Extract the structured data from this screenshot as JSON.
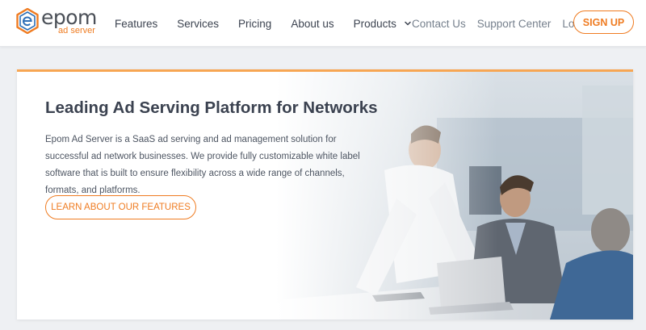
{
  "brand": {
    "name": "epom",
    "subtitle": "ad server",
    "accent": "#ef7c22",
    "highlight_bar": "#f7a653"
  },
  "nav": {
    "primary": [
      {
        "label": "Features"
      },
      {
        "label": "Services"
      },
      {
        "label": "Pricing"
      },
      {
        "label": "About us"
      },
      {
        "label": "Products"
      }
    ],
    "secondary": [
      {
        "label": "Contact Us"
      },
      {
        "label": "Support Center"
      },
      {
        "label": "Login"
      }
    ],
    "signup_label": "SIGN UP",
    "products_icon": "chevron-down-icon"
  },
  "hero": {
    "title": "Leading Ad Serving Platform for Networks",
    "description": "Epom Ad Server is a SaaS ad serving and ad management solution for successful ad network businesses. We provide fully customizable white label software that is built to ensure flexibility across a wide range of channels, formats, and platforms.",
    "cta_label": "LEARN ABOUT OUR FEATURES"
  }
}
